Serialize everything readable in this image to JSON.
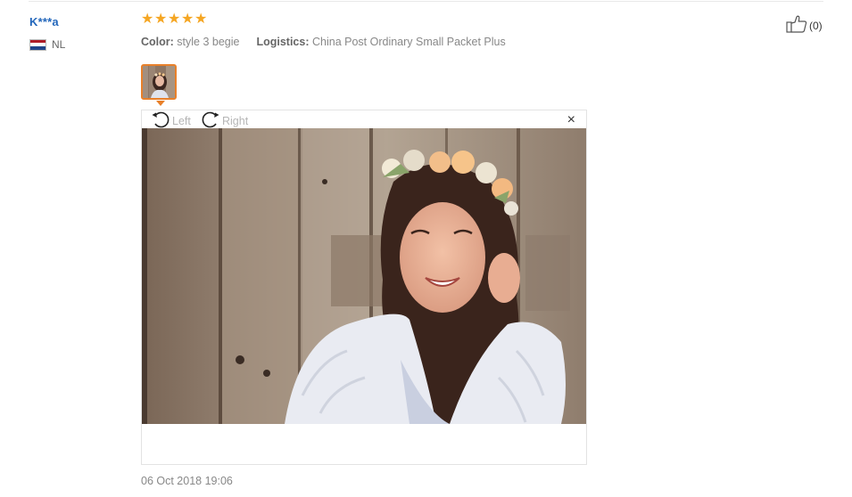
{
  "review": {
    "user_name": "K***a",
    "country_code": "NL",
    "rating": 5,
    "rating_max": 5,
    "color_label": "Color:",
    "color_value": "style 3 begie",
    "logistics_label": "Logistics:",
    "logistics_value": "China Post Ordinary Small Packet Plus",
    "helpful_count": "(0)",
    "date": "06 Oct 2018 19:06"
  },
  "viewer": {
    "rotate_left_label": "Left",
    "rotate_right_label": "Right",
    "close_symbol": "×"
  },
  "icons": {
    "flag": "netherlands-flag-icon",
    "star": "star-icon",
    "helpful": "thumbs-up-icon",
    "rotate_left": "rotate-left-icon",
    "rotate_right": "rotate-right-icon",
    "close": "close-icon"
  },
  "colors": {
    "user_link": "#2266bb",
    "star": "#f5a623",
    "thumbnail_border": "#e8802a",
    "flag_red": "#ae1c28",
    "flag_white": "#ffffff",
    "flag_blue": "#21468b"
  }
}
